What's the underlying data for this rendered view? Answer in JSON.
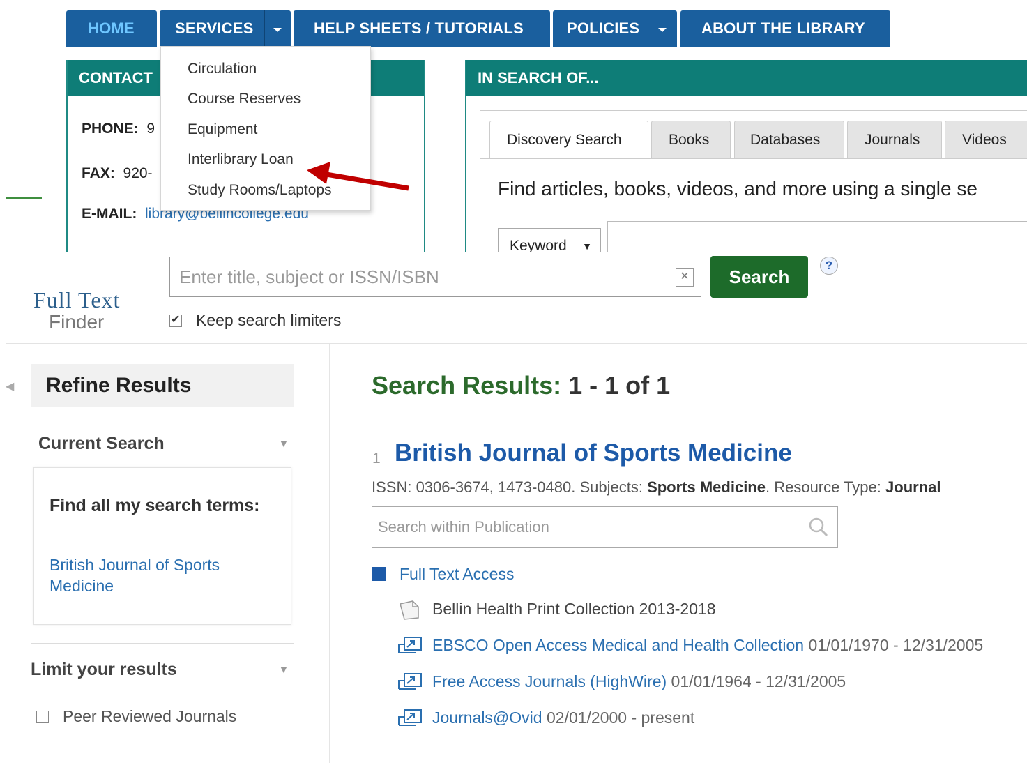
{
  "nav": {
    "home": "HOME",
    "services": "SERVICES",
    "help": "HELP SHEETS / TUTORIALS",
    "policies": "POLICIES",
    "about": "ABOUT THE LIBRARY"
  },
  "services_menu": [
    "Circulation",
    "Course Reserves",
    "Equipment",
    "Interlibrary Loan",
    "Study Rooms/Laptops"
  ],
  "contact": {
    "title": "CONTACT",
    "phone_label": "PHONE:",
    "phone_value": "9",
    "fax_label": "FAX:",
    "fax_value": "920-",
    "email_label": "E-MAIL:",
    "email_value": "library@bellincollege.edu"
  },
  "search_panel": {
    "title": "IN SEARCH OF...",
    "tabs": [
      "Discovery Search",
      "Books",
      "Databases",
      "Journals",
      "Videos"
    ],
    "description": "Find articles, books, videos, and more using a single se",
    "search_type": "Keyword"
  },
  "ftf": {
    "logo_line1": "Full Text",
    "logo_line2": "Finder",
    "placeholder": "Enter title, subject or ISSN/ISBN",
    "search_button": "Search",
    "help": "?",
    "keep_limiters": "Keep search limiters",
    "keep_checked": true
  },
  "refine": {
    "title": "Refine Results",
    "current_search": "Current Search",
    "find_all_label": "Find all my search terms:",
    "term": "British Journal of Sports Medicine",
    "limit_title": "Limit your results",
    "limit_option": "Peer Reviewed Journals"
  },
  "results": {
    "label": "Search Results:",
    "range": "1 - 1 of 1",
    "item_number": "1",
    "journal_title": "British Journal of Sports Medicine",
    "meta_issn": "ISSN: 0306-3674, 1473-0480. Subjects:",
    "meta_subject": "Sports Medicine",
    "meta_type_label": ". Resource Type:",
    "meta_type": "Journal",
    "search_within_placeholder": "Search within Publication",
    "full_text_access": "Full Text Access",
    "providers": [
      {
        "name": "Bellin Health Print Collection 2013-2018",
        "dates": "",
        "icon": "print-icon"
      },
      {
        "name": "EBSCO Open Access Medical and Health Collection",
        "dates": "01/01/1970 - 12/31/2005",
        "icon": "online-icon"
      },
      {
        "name": "Free Access Journals (HighWire)",
        "dates": "01/01/1964 - 12/31/2005",
        "icon": "online-icon"
      },
      {
        "name": "Journals@Ovid",
        "dates": "02/01/2000 - present",
        "icon": "online-icon"
      }
    ]
  },
  "colors": {
    "nav_blue": "#1a5f9e",
    "teal": "#0e7d77",
    "search_green": "#1d6b2a",
    "link_blue": "#2a6fb0",
    "arrow_red": "#c00000"
  }
}
